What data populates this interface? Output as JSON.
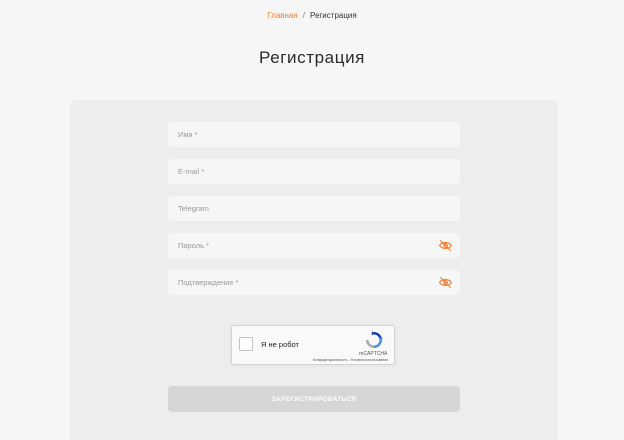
{
  "breadcrumb": {
    "home": "Главная",
    "separator": "/",
    "current": "Регистрация"
  },
  "page": {
    "title": "Регистрация"
  },
  "form": {
    "name_placeholder": "Имя *",
    "email_placeholder": "E-mail *",
    "telegram_placeholder": "Telegram",
    "password_placeholder": "Пароль *",
    "confirm_placeholder": "Подтверждение *",
    "submit_label": "ЗАРЕГИСТРИРОВАТЬСЯ"
  },
  "captcha": {
    "label": "Я не робот",
    "brand": "reCAPTCHA",
    "privacy": "Конфиденциальность",
    "links_separator": " - ",
    "terms": "Условия использования"
  },
  "icons": {
    "password_toggle": "eye-off-icon",
    "confirm_toggle": "eye-off-icon",
    "captcha_logo": "recaptcha-logo-icon"
  },
  "colors": {
    "accent": "#f07e2e",
    "page_background": "#f6f6f6",
    "card_background": "#ededed",
    "submit_disabled": "#d6d6d6"
  }
}
